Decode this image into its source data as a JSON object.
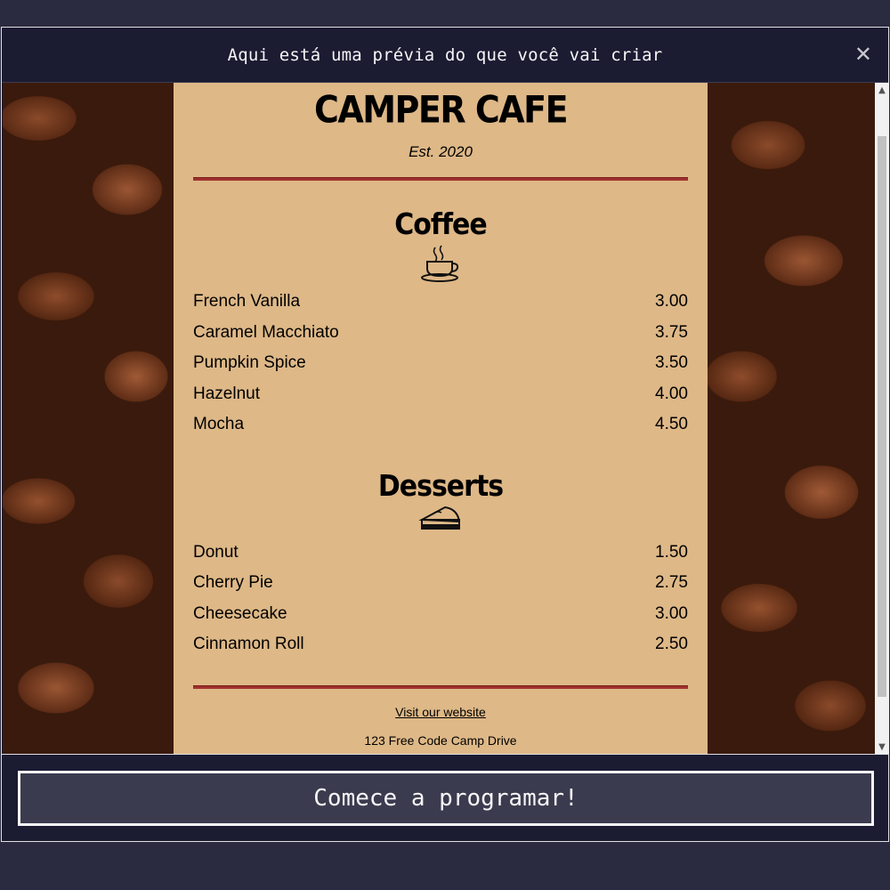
{
  "modal": {
    "title": "Aqui está uma prévia do que você vai criar",
    "close_icon": "close-icon",
    "cta_label": "Comece a programar!"
  },
  "menu": {
    "title": "CAMPER CAFE",
    "established": "Est. 2020",
    "sections": [
      {
        "title": "Coffee",
        "icon": "coffee-cup-icon",
        "items": [
          {
            "name": "French Vanilla",
            "price": "3.00"
          },
          {
            "name": "Caramel Macchiato",
            "price": "3.75"
          },
          {
            "name": "Pumpkin Spice",
            "price": "3.50"
          },
          {
            "name": "Hazelnut",
            "price": "4.00"
          },
          {
            "name": "Mocha",
            "price": "4.50"
          }
        ]
      },
      {
        "title": "Desserts",
        "icon": "pie-slice-icon",
        "items": [
          {
            "name": "Donut",
            "price": "1.50"
          },
          {
            "name": "Cherry Pie",
            "price": "2.75"
          },
          {
            "name": "Cheesecake",
            "price": "3.00"
          },
          {
            "name": "Cinnamon Roll",
            "price": "2.50"
          }
        ]
      }
    ],
    "footer": {
      "link_text": "Visit our website",
      "address": "123 Free Code Camp Drive"
    }
  },
  "colors": {
    "page_bg": "#2a2a40",
    "modal_bg": "#1b1b32",
    "menu_bg": "#deb887",
    "divider": "#a0312f",
    "button_bg": "#3b3b4f"
  }
}
